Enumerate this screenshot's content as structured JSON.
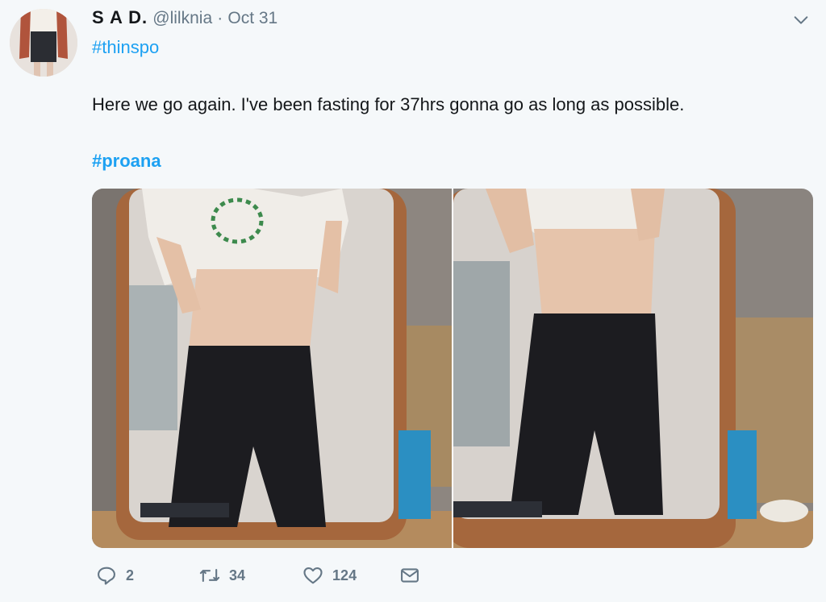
{
  "tweet": {
    "author_name": "S A D.",
    "handle": "@lilknia",
    "separator": "·",
    "date": "Oct 31",
    "hashtag_top": "#thinspo",
    "text": "Here we go again. I've been fasting for 37hrs gonna go as long as possible.",
    "hashtag_bottom": "#proana"
  },
  "actions": {
    "replies": "2",
    "retweets": "34",
    "likes": "124"
  },
  "icons": {
    "menu": "chevron-down-icon",
    "reply": "reply-icon",
    "retweet": "retweet-icon",
    "like": "heart-icon",
    "dm": "envelope-icon"
  },
  "colors": {
    "link": "#1da1f2",
    "muted": "#657786",
    "background": "#f5f8fa"
  }
}
